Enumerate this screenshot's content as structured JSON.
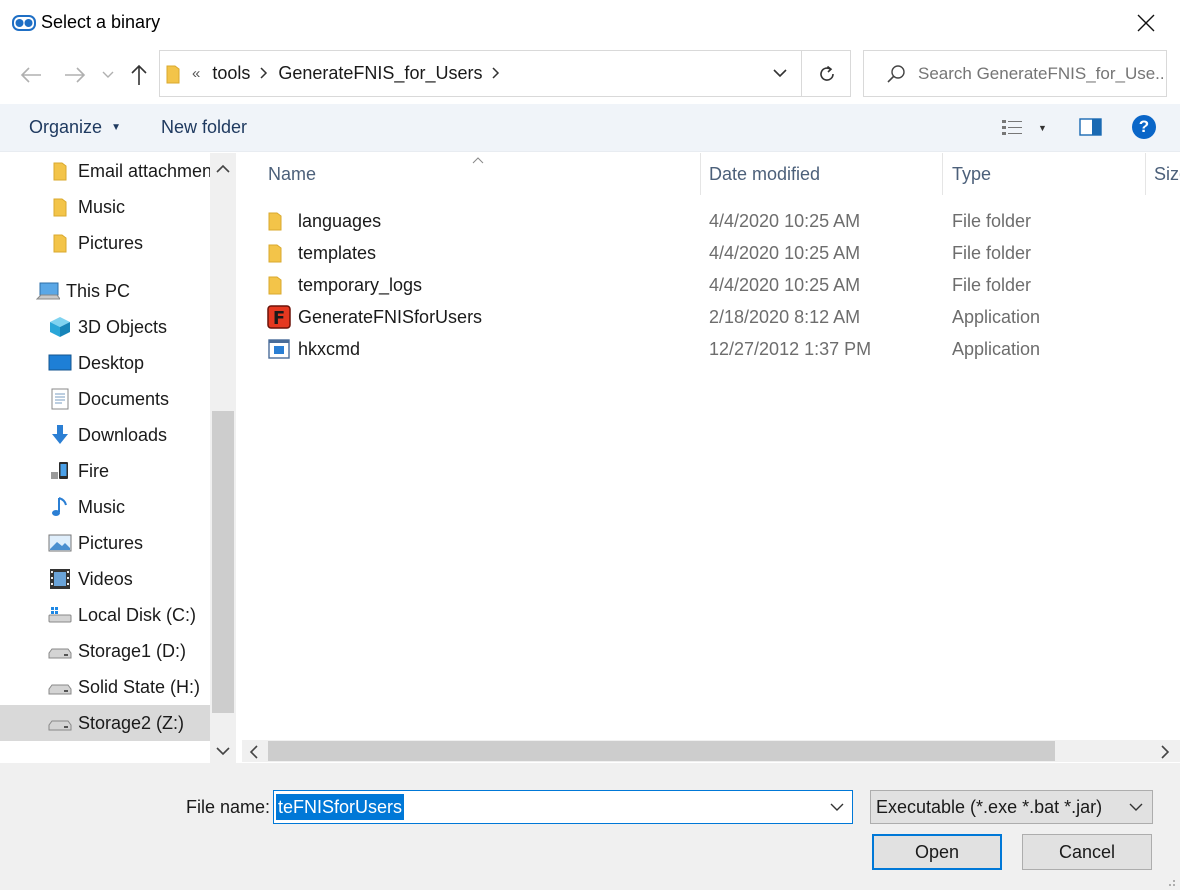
{
  "window": {
    "title": "Select a binary"
  },
  "address": {
    "overflow": "«",
    "crumbs": [
      "tools",
      "GenerateFNIS_for_Users"
    ],
    "search_placeholder": "Search GenerateFNIS_for_Use..."
  },
  "toolbar": {
    "organize": "Organize",
    "new_folder": "New folder"
  },
  "sidebar": {
    "items": [
      {
        "label": "Email attachmen",
        "icon": "folder-icon"
      },
      {
        "label": "Music",
        "icon": "folder-icon"
      },
      {
        "label": "Pictures",
        "icon": "folder-icon"
      },
      {
        "label": "This PC",
        "icon": "computer-icon"
      },
      {
        "label": "3D Objects",
        "icon": "3d-objects-icon"
      },
      {
        "label": "Desktop",
        "icon": "desktop-icon"
      },
      {
        "label": "Documents",
        "icon": "documents-icon"
      },
      {
        "label": "Downloads",
        "icon": "download-arrow-icon"
      },
      {
        "label": "Fire",
        "icon": "device-icon"
      },
      {
        "label": "Music",
        "icon": "music-note-icon"
      },
      {
        "label": "Pictures",
        "icon": "pictures-icon"
      },
      {
        "label": "Videos",
        "icon": "videos-icon"
      },
      {
        "label": "Local Disk (C:)",
        "icon": "windows-drive-icon"
      },
      {
        "label": "Storage1 (D:)",
        "icon": "drive-icon"
      },
      {
        "label": "Solid State (H:)",
        "icon": "drive-icon"
      },
      {
        "label": "Storage2 (Z:)",
        "icon": "drive-icon"
      }
    ],
    "selected_index": 15
  },
  "filelist": {
    "columns": [
      "Name",
      "Date modified",
      "Type",
      "Size"
    ],
    "rows": [
      {
        "name": "languages",
        "date": "4/4/2020 10:25 AM",
        "type": "File folder",
        "icon": "folder-icon"
      },
      {
        "name": "templates",
        "date": "4/4/2020 10:25 AM",
        "type": "File folder",
        "icon": "folder-icon"
      },
      {
        "name": "temporary_logs",
        "date": "4/4/2020 10:25 AM",
        "type": "File folder",
        "icon": "folder-icon"
      },
      {
        "name": "GenerateFNISforUsers",
        "date": "2/18/2020 8:12 AM",
        "type": "Application",
        "icon": "fnis-app-icon"
      },
      {
        "name": "hkxcmd",
        "date": "12/27/2012 1:37 PM",
        "type": "Application",
        "icon": "window-app-icon"
      }
    ]
  },
  "bottom": {
    "file_name_label": "File name:",
    "file_name_value": "teFNISforUsers",
    "filter_value": "Executable (*.exe *.bat *.jar)",
    "open": "Open",
    "cancel": "Cancel"
  },
  "colors": {
    "accent": "#0078d7",
    "folder": "#f3c449",
    "toolbar_bg": "#f0f4f9"
  }
}
